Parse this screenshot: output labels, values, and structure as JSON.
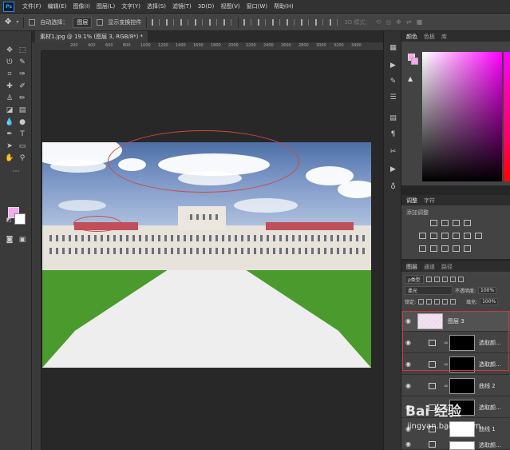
{
  "app": {
    "logo": "Ps"
  },
  "menu": [
    "文件(F)",
    "编辑(E)",
    "图像(I)",
    "图层(L)",
    "文字(Y)",
    "选择(S)",
    "滤镜(T)",
    "3D(D)",
    "视图(V)",
    "窗口(W)",
    "帮助(H)"
  ],
  "options": {
    "auto_select_label": "自动选择：",
    "auto_select_value": "图层",
    "show_transform_label": "显示变换控件",
    "mode3d_label": "3D 模式："
  },
  "document": {
    "tab_title": "素材1.jpg @ 19.1% (图层 3, RGB/8*) *"
  },
  "ruler": {
    "ticks": [
      "200",
      "400",
      "600",
      "800",
      "1000",
      "1200",
      "1400",
      "1600",
      "1800",
      "2000",
      "2200",
      "2400",
      "2600",
      "2800",
      "3000",
      "3200",
      "3400",
      "3600",
      "3800"
    ]
  },
  "colors": {
    "foreground": "#f6a8f0",
    "background": "#ffffff",
    "annotation": "#c93b3b"
  },
  "panels": {
    "color": {
      "tabs": [
        "颜色",
        "色板",
        "库"
      ]
    },
    "adjustments": {
      "tabs": [
        "调整",
        "字符"
      ],
      "title": "添加调整"
    },
    "layers": {
      "tabs": [
        "图层",
        "通道",
        "路径"
      ],
      "filter_kind": "ρ类型",
      "blend_mode": "柔光",
      "opacity_label": "不透明度:",
      "opacity_value": "100%",
      "lock_label": "锁定:",
      "fill_label": "填充:",
      "fill_value": "100%",
      "items": [
        {
          "name": "图层 3"
        },
        {
          "name": "选取颜..."
        },
        {
          "name": "选取颜..."
        },
        {
          "name": "曲线 2"
        },
        {
          "name": "选取颜..."
        },
        {
          "name": "曲线 1"
        },
        {
          "name": "选取颜..."
        }
      ]
    }
  },
  "watermark": {
    "text": "Bai 经验",
    "url": "jingyan.baidu.com"
  }
}
